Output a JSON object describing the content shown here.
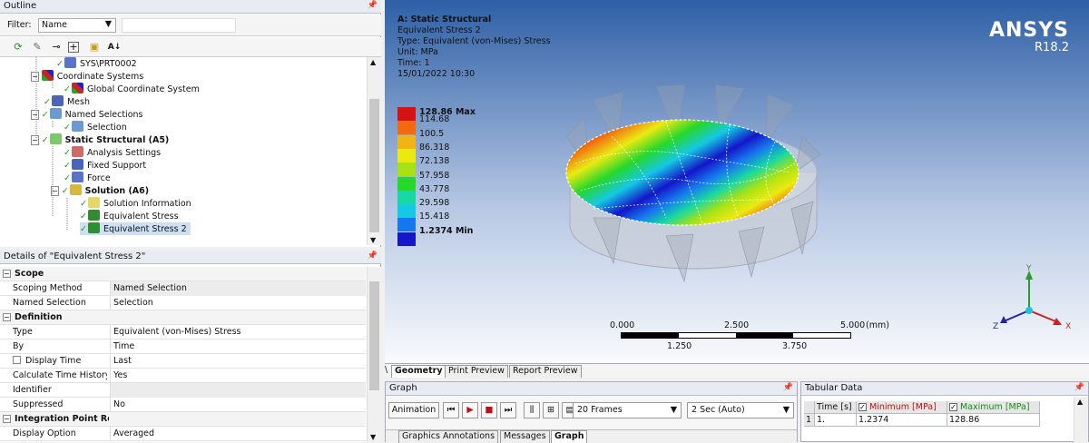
{
  "outline": {
    "title": "Outline",
    "filter_label": "Filter:",
    "filter_value": "Name",
    "tree": [
      {
        "label": "SYS\\PRT0002",
        "level": 4
      },
      {
        "label": "Coordinate Systems",
        "level": 2
      },
      {
        "label": "Global Coordinate System",
        "level": 3
      },
      {
        "label": "Mesh",
        "level": 2
      },
      {
        "label": "Named Selections",
        "level": 2
      },
      {
        "label": "Selection",
        "level": 3
      },
      {
        "label": "Static Structural (A5)",
        "level": 2,
        "bold": true
      },
      {
        "label": "Analysis Settings",
        "level": 3
      },
      {
        "label": "Fixed Support",
        "level": 3
      },
      {
        "label": "Force",
        "level": 3
      },
      {
        "label": "Solution (A6)",
        "level": 3,
        "bold": true
      },
      {
        "label": "Solution Information",
        "level": 4
      },
      {
        "label": "Equivalent Stress",
        "level": 4
      },
      {
        "label": "Equivalent Stress 2",
        "level": 4,
        "selected": true
      }
    ]
  },
  "details": {
    "title": "Details of \"Equivalent Stress 2\"",
    "rows": [
      {
        "type": "head",
        "k": "Scope",
        "mk": "−"
      },
      {
        "k": "Scoping Method",
        "v": "Named Selection",
        "gray": true
      },
      {
        "k": "Named Selection",
        "v": "Selection"
      },
      {
        "type": "head",
        "k": "Definition",
        "mk": "−"
      },
      {
        "k": "Type",
        "v": "Equivalent (von-Mises) Stress"
      },
      {
        "k": "By",
        "v": "Time"
      },
      {
        "k": "Display Time",
        "v": "Last",
        "box": true
      },
      {
        "k": "Calculate Time History",
        "v": "Yes"
      },
      {
        "k": "Identifier",
        "v": "",
        "gray": true
      },
      {
        "k": "Suppressed",
        "v": "No"
      },
      {
        "type": "head",
        "k": "Integration Point Results",
        "mk": "−"
      },
      {
        "k": "Display Option",
        "v": "Averaged"
      }
    ]
  },
  "viewport": {
    "header": [
      "A: Static Structural",
      "Equivalent Stress 2",
      "Type: Equivalent (von-Mises) Stress",
      "Unit: MPa",
      "Time: 1",
      "15/01/2022 10:30"
    ],
    "brand": "ANSYS",
    "version": "R18.2",
    "legend": [
      {
        "v": "128.86 Max",
        "c": "#d41414",
        "bold": true
      },
      {
        "v": "114.68",
        "c": "#f26a10"
      },
      {
        "v": "100.5",
        "c": "#f2b412"
      },
      {
        "v": "86.318",
        "c": "#eaea12"
      },
      {
        "v": "72.138",
        "c": "#a8e214"
      },
      {
        "v": "57.958",
        "c": "#26d82a"
      },
      {
        "v": "43.778",
        "c": "#17d8a3"
      },
      {
        "v": "29.598",
        "c": "#15c8e4"
      },
      {
        "v": "15.418",
        "c": "#1677ef"
      },
      {
        "v": "1.2374 Min",
        "c": "#1416c8",
        "bold": true
      }
    ],
    "scale": {
      "top": [
        "0.000",
        "2.500",
        "5.000"
      ],
      "unit": "(mm)",
      "bottom": [
        "1.250",
        "3.750"
      ]
    },
    "axes": {
      "x": "X",
      "y": "Y",
      "z": "Z"
    }
  },
  "viewtabs": [
    "Geometry",
    "Print Preview",
    "Report Preview"
  ],
  "graph": {
    "title": "Graph",
    "animation_label": "Animation",
    "frames": "20 Frames",
    "duration": "2 Sec (Auto)",
    "tabs": [
      "Graphics Annotations",
      "Messages",
      "Graph"
    ]
  },
  "tabular": {
    "title": "Tabular Data",
    "headers": [
      "Time [s]",
      "Minimum [MPa]",
      "Maximum [MPa]"
    ],
    "rows": [
      [
        "1",
        "1.",
        "1.2374",
        "128.86"
      ]
    ]
  }
}
